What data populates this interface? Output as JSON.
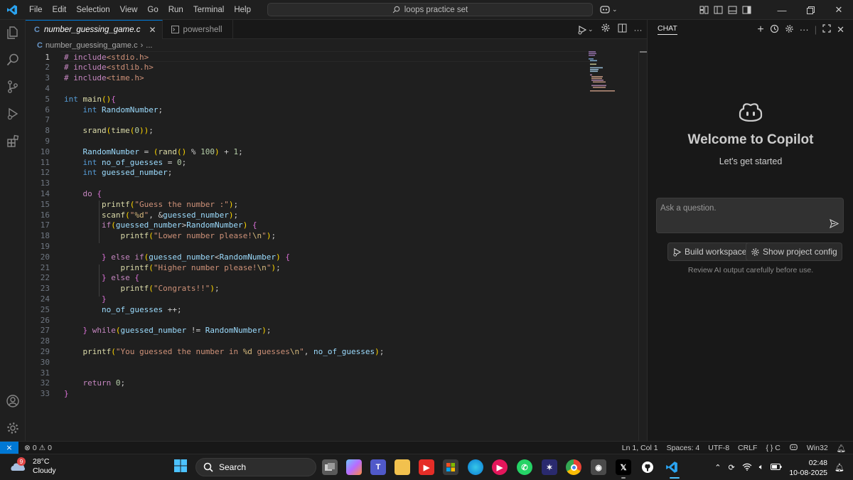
{
  "titlebar": {
    "menu": [
      "File",
      "Edit",
      "Selection",
      "View",
      "Go",
      "Run",
      "Terminal",
      "Help"
    ],
    "search_text": "loops practice set"
  },
  "tabs": [
    {
      "label": "number_guessing_game.c",
      "active": true
    },
    {
      "label": "powershell",
      "active": false
    }
  ],
  "breadcrumb": {
    "file": "number_guessing_game.c",
    "more": "..."
  },
  "code": {
    "current_line": 1,
    "lines": [
      {
        "n": "1",
        "t": "# include<stdio.h>"
      },
      {
        "n": "2",
        "t": "# include<stdlib.h>"
      },
      {
        "n": "3",
        "t": "# include<time.h>"
      },
      {
        "n": "4",
        "t": ""
      },
      {
        "n": "5",
        "t": "int main(){"
      },
      {
        "n": "6",
        "t": "    int RandomNumber;"
      },
      {
        "n": "7",
        "t": ""
      },
      {
        "n": "8",
        "t": "    srand(time(0));"
      },
      {
        "n": "9",
        "t": ""
      },
      {
        "n": "10",
        "t": "    RandomNumber = (rand() % 100) + 1;"
      },
      {
        "n": "11",
        "t": "    int no_of_guesses = 0;"
      },
      {
        "n": "12",
        "t": "    int guessed_number;"
      },
      {
        "n": "13",
        "t": ""
      },
      {
        "n": "14",
        "t": "    do {"
      },
      {
        "n": "15",
        "t": "        printf(\"Guess the number :\");"
      },
      {
        "n": "16",
        "t": "        scanf(\"%d\", &guessed_number);"
      },
      {
        "n": "17",
        "t": "        if(guessed_number>RandomNumber) {"
      },
      {
        "n": "18",
        "t": "            printf(\"Lower number please!\\n\");"
      },
      {
        "n": "19",
        "t": ""
      },
      {
        "n": "20",
        "t": "        } else if(guessed_number<RandomNumber) {"
      },
      {
        "n": "21",
        "t": "            printf(\"Higher number please!\\n\");"
      },
      {
        "n": "22",
        "t": "        } else {"
      },
      {
        "n": "23",
        "t": "            printf(\"Congrats!!\");"
      },
      {
        "n": "24",
        "t": "        }"
      },
      {
        "n": "25",
        "t": "        no_of_guesses ++;"
      },
      {
        "n": "26",
        "t": ""
      },
      {
        "n": "27",
        "t": "    } while(guessed_number != RandomNumber);"
      },
      {
        "n": "28",
        "t": ""
      },
      {
        "n": "29",
        "t": "    printf(\"You guessed the number in %d guesses\\n\", no_of_guesses);"
      },
      {
        "n": "30",
        "t": ""
      },
      {
        "n": "31",
        "t": ""
      },
      {
        "n": "32",
        "t": "    return 0;"
      },
      {
        "n": "33",
        "t": "}"
      }
    ]
  },
  "chat": {
    "header": "CHAT",
    "title": "Welcome to Copilot",
    "subtitle": "Let's get started",
    "placeholder": "Ask a question.",
    "chip_build": "Build workspace",
    "chip_config": "Show project config",
    "review": "Review AI output carefully before use."
  },
  "statusbar": {
    "problems_errors": "0",
    "problems_warnings": "0",
    "position": "Ln 1, Col 1",
    "spaces": "Spaces: 4",
    "encoding": "UTF-8",
    "eol": "CRLF",
    "language": "{ } C",
    "platform": "Win32"
  },
  "taskbar": {
    "temperature": "28°C",
    "condition": "Cloudy",
    "weather_badge": "9",
    "search": "Search",
    "time": "02:48",
    "date": "10-08-2025"
  },
  "colors": {
    "accent": "#0078d4",
    "keyword": "#569cd6",
    "control": "#c586c0",
    "string": "#ce9178",
    "function": "#dcdcaa",
    "variable": "#9cdcfe",
    "number": "#b5cea8"
  }
}
